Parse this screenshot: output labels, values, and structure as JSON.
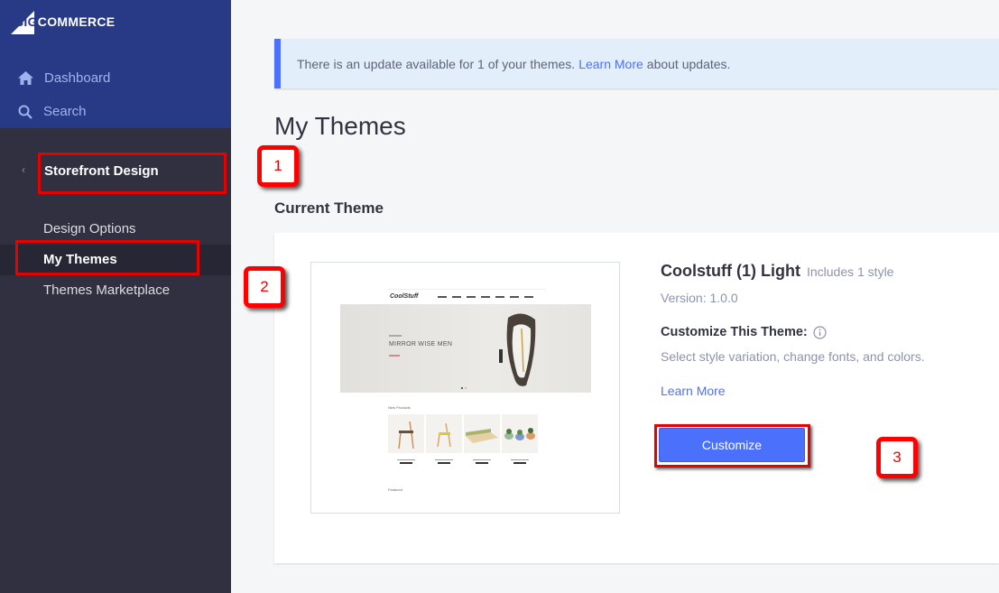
{
  "brand": {
    "logo_big": "BIG",
    "logo_rest": "COMMERCE"
  },
  "sidebar": {
    "top_items": [
      {
        "label": "Dashboard",
        "icon": "home-icon"
      },
      {
        "label": "Search",
        "icon": "search-icon"
      }
    ],
    "back_glyph": "‹",
    "section_title": "Storefront Design",
    "items": [
      {
        "label": "Design Options",
        "active": false
      },
      {
        "label": "My Themes",
        "active": true
      },
      {
        "label": "Themes Marketplace",
        "active": false
      }
    ]
  },
  "notice": {
    "text_before": "There is an update available for 1 of your themes.",
    "link": "Learn More",
    "text_after": "about updates."
  },
  "page": {
    "title": "My Themes",
    "section_title": "Current Theme"
  },
  "theme": {
    "name": "Coolstuff (1) Light",
    "includes": "Includes 1 style",
    "version": "Version: 1.0.0",
    "customize_heading": "Customize This Theme:",
    "customize_desc": "Select style variation, change fonts, and colors.",
    "learn_more": "Learn More",
    "customize_button": "Customize",
    "preview": {
      "logo": "CoolStuff",
      "hero_title": "MIRROR WISE MEN",
      "new_products": "New Products",
      "featured": "Featured"
    }
  },
  "annotations": [
    "1",
    "2",
    "3"
  ],
  "colors": {
    "accent": "#4b71fc",
    "sidebar_top": "#283a85",
    "sidebar": "#313040",
    "highlight": "#e60000"
  }
}
